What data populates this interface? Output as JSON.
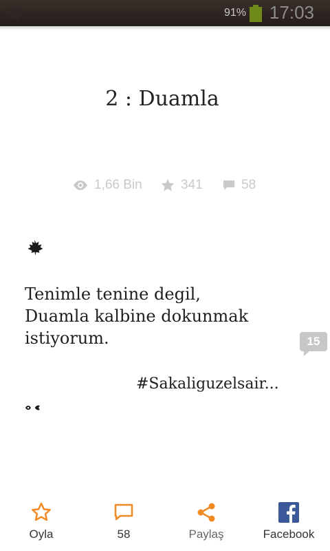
{
  "status_bar": {
    "battery": "91%",
    "time": "17:03"
  },
  "story": {
    "title": "2 : Duamla",
    "stats": {
      "views": "1,66 Bin",
      "votes": "341",
      "comments": "58"
    },
    "lines": [
      "Tenimle tenine degil,",
      "Duamla kalbine dokunmak",
      "istiyorum."
    ],
    "inline_comment_count": "15",
    "hashtag": "#Sakaliguzelsair..."
  },
  "bottom_bar": {
    "vote_label": "Oyla",
    "comments_label": "58",
    "share_label": "Paylaş",
    "facebook_label": "Facebook"
  },
  "colors": {
    "accent": "#f08a24",
    "facebook": "#3b5998",
    "muted": "#c9c9c9"
  }
}
